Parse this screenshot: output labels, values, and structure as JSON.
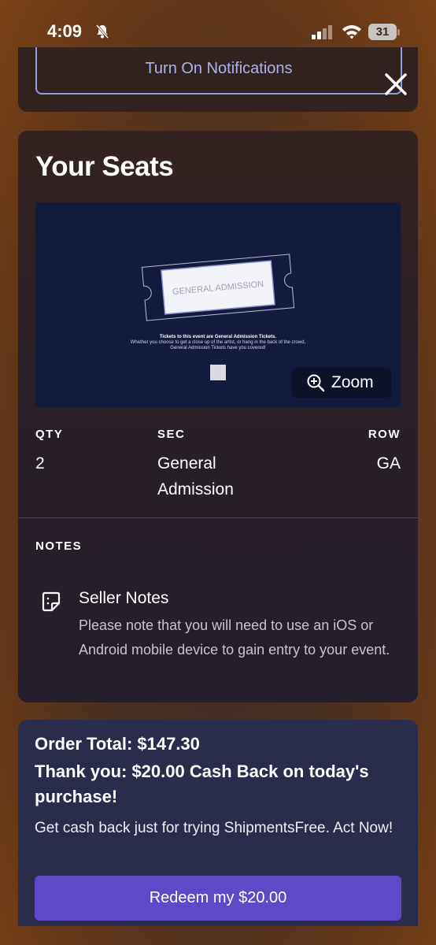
{
  "status_bar": {
    "time": "4:09",
    "battery": "31"
  },
  "notification": {
    "button_label": "Turn On Notifications"
  },
  "seats": {
    "title": "Your Seats",
    "map": {
      "ticket_label": "GENERAL ADMISSION",
      "caption_bold": "Tickets to this event are General Admission Tickets.",
      "caption": "Whether you choose to get a close up of the artist, or hang in the back of the crowd, General Admission Tickets have you covered!",
      "zoom_label": "Zoom"
    },
    "qty_label": "QTY",
    "qty_value": "2",
    "sec_label": "SEC",
    "sec_value_line1": "General",
    "sec_value_line2": "Admission",
    "row_label": "ROW",
    "row_value": "GA",
    "notes_label": "NOTES",
    "note_title": "Seller Notes",
    "note_body": "Please note that you will need to use an iOS or Android mobile device to gain entry to your event."
  },
  "order": {
    "total": "Order Total: $147.30",
    "thanks": "Thank you: $20.00 Cash Back on today's purchase!",
    "promo": "Get cash back just for trying ShipmentsFree. Act Now!",
    "redeem_label": "Redeem my $20.00"
  },
  "colors": {
    "accent_button": "#5f49c9",
    "link": "#a9b4ec",
    "map_bg": "#121a3e"
  }
}
